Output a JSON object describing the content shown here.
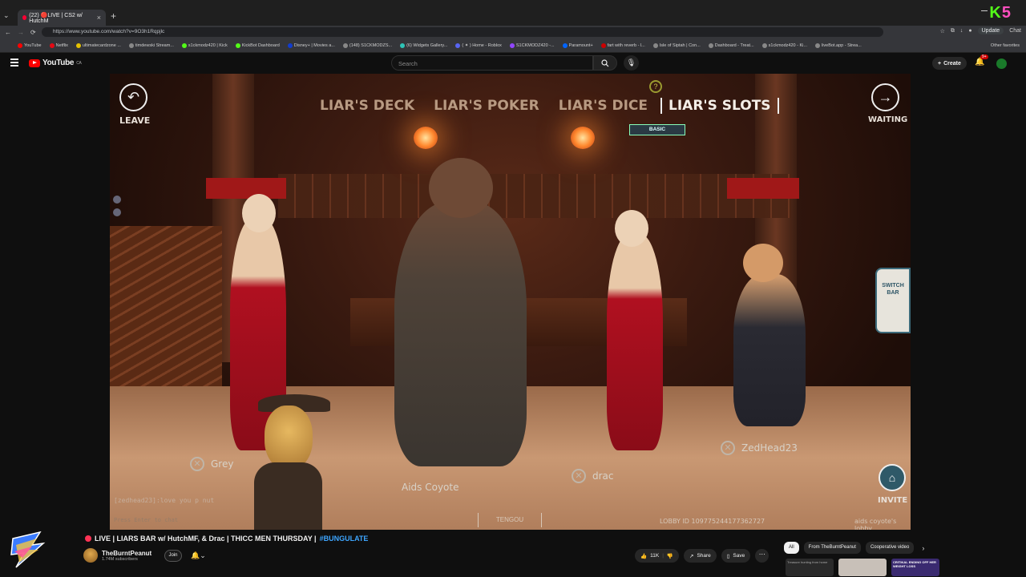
{
  "browser": {
    "tab_title": "(22) 🔴LIVE | CS2 w/ HutchM",
    "url": "https://www.youtube.com/watch?v=9O3h1Rqpjlc",
    "update_label": "Update",
    "chat_label": "Chat",
    "bookmarks": [
      "YouTube",
      "Netflix",
      "ultimatecardzone ...",
      "timdewski Stream...",
      "s1ckmodz420 | Kick",
      "KickBot Dashboard",
      "Disney+ | Movies a...",
      "(148) S1CKMODZS...",
      "(6) Widgets Gallery...",
      "( ✦ ) Home - Roblox",
      "S1CKMODZ420 -...",
      "Paramount+",
      "fart with reverb - l...",
      "Isle of Siptah | Con...",
      "Dashboard - Treat...",
      "s1ckmodz420 - Ki...",
      "liveBot.app - Strea..."
    ],
    "other_favorites": "Other favorites",
    "kick_logo": "K5"
  },
  "youtube": {
    "logo_text": "YouTube",
    "logo_region": "CA",
    "search_placeholder": "Search",
    "create_label": "Create",
    "notif_count": "9+"
  },
  "game": {
    "tabs": [
      "LIAR'S DECK",
      "LIAR'S POKER",
      "LIAR'S DICE",
      "LIAR'S SLOTS"
    ],
    "active_tab": "LIAR'S SLOTS",
    "mode_tag": "BASIC",
    "leave_label": "LEAVE",
    "waiting_label": "WAITING",
    "switch_bar_label": "SWITCH BAR",
    "invite_label": "INVITE",
    "players": [
      "Grey",
      "Aids Coyote",
      "drac",
      "ZedHead23"
    ],
    "chat_message": "[zedhead23]:love you p nut",
    "chat_hint": "Press Enter to chat",
    "lobby_id": "LOBBY ID 109775244177362727",
    "lobby_name": "aids coyote's lobby",
    "center_name": "TENGOU"
  },
  "video": {
    "live_prefix": "LIVE | LIARS BAR w/ HutchMF, & Drac | THICC MEN THURSDAY |",
    "hashtag": "#BUNGULATE",
    "channel_name": "TheBurntPeanut",
    "subscribers": "1.74M subscribers",
    "join_label": "Join",
    "like_count": "11K",
    "share_label": "Share",
    "save_label": "Save"
  },
  "related": {
    "chips": [
      "All",
      "From TheBurntPeanut",
      "Cooperative video"
    ],
    "thumb_texts": [
      "Treasure hunting from home",
      "",
      "CRITIKAL ENDING OFF HER WEIGHT LOSS"
    ]
  }
}
